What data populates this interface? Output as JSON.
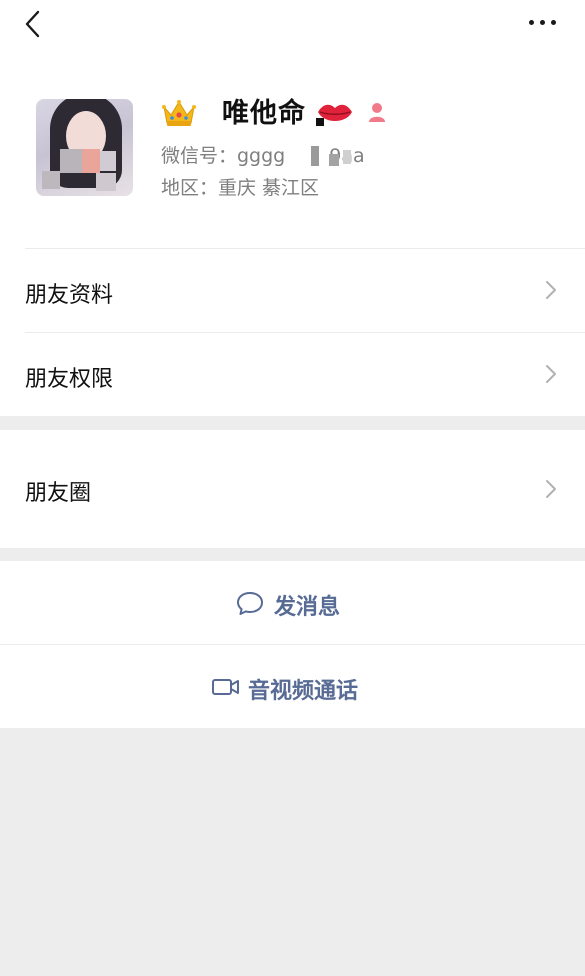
{
  "profile": {
    "nickname": "唯他命",
    "crown_emoji": "crown-icon",
    "trailing_emoji": "lips-icon",
    "gender_icon": "female-icon",
    "wechat_id": "微信号：gggg　　 9aa",
    "region": "地区：重庆 綦江区"
  },
  "menu": {
    "friend_info": "朋友资料",
    "friend_permissions": "朋友权限",
    "moments": "朋友圈"
  },
  "actions": {
    "send_message": "发消息",
    "video_call": "音视频通话"
  },
  "colors": {
    "link_blue": "#576b95",
    "background": "#ededed",
    "gender_pink": "#f07a8a"
  }
}
